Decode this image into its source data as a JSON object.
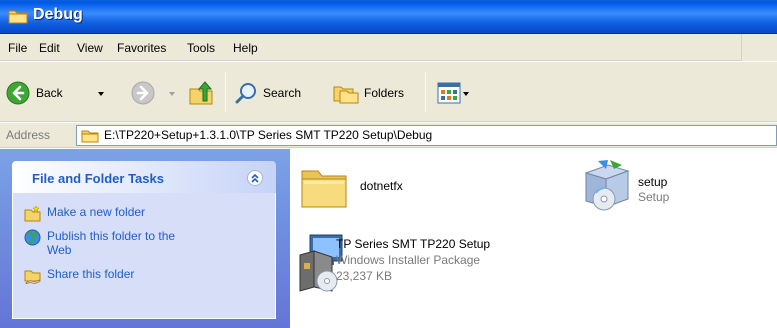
{
  "window": {
    "title": "Debug"
  },
  "menu": [
    "File",
    "Edit",
    "View",
    "Favorites",
    "Tools",
    "Help"
  ],
  "toolbar": {
    "back_label": "Back",
    "search_label": "Search",
    "folders_label": "Folders"
  },
  "address": {
    "label": "Address",
    "value": "E:\\TP220+Setup+1.3.1.0\\TP Series SMT TP220 Setup\\Debug"
  },
  "tasks": {
    "title": "File and Folder Tasks",
    "items": [
      {
        "label": "Make a new folder",
        "icon": "new-folder-icon"
      },
      {
        "label": "Publish this folder to the Web",
        "icon": "publish-web-icon"
      },
      {
        "label": "Share this folder",
        "icon": "share-folder-icon"
      }
    ]
  },
  "files": [
    {
      "name": "dotnetfx",
      "type": "",
      "size": "",
      "icon": "folder-icon"
    },
    {
      "name": "setup",
      "type": "Setup",
      "size": "",
      "icon": "setup-icon"
    },
    {
      "name": "TP Series SMT TP220 Setup",
      "type": "Windows Installer Package",
      "size": "23,237 KB",
      "icon": "installer-icon"
    }
  ],
  "colors": {
    "title_bar": "#0058e6",
    "task_link": "#215dc6",
    "chrome": "#ece9d8"
  }
}
